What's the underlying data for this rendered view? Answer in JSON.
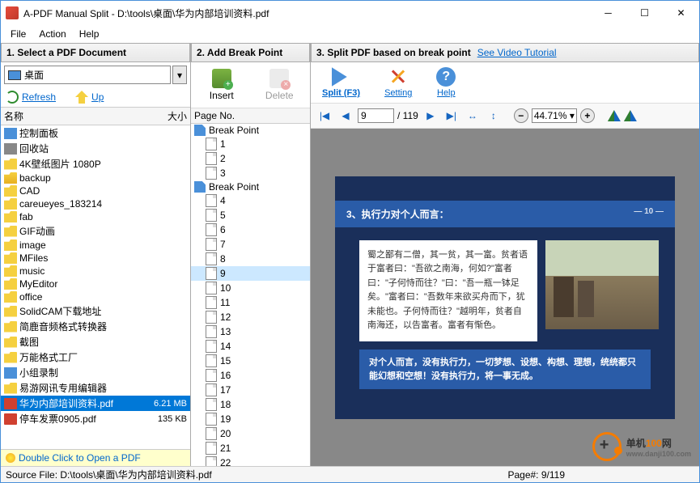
{
  "window": {
    "title": "A-PDF Manual Split - D:\\tools\\桌面\\华为内部培训资料.pdf"
  },
  "menu": {
    "file": "File",
    "action": "Action",
    "help": "Help"
  },
  "panels": {
    "left_title": "1. Select a PDF Document",
    "mid_title": "2. Add Break Point",
    "right_title": "3. Split PDF based on break point",
    "video_link": "See Video Tutorial"
  },
  "drive": {
    "label": "桌面"
  },
  "actions": {
    "refresh": "Refresh",
    "up": "Up"
  },
  "file_cols": {
    "name": "名称",
    "size": "大小"
  },
  "files": [
    {
      "icon": "ctrl",
      "name": "控制面板",
      "size": ""
    },
    {
      "icon": "bin",
      "name": "回收站",
      "size": ""
    },
    {
      "icon": "folder",
      "name": "4K壁纸图片 1080P",
      "size": ""
    },
    {
      "icon": "folder-open",
      "name": "backup",
      "size": ""
    },
    {
      "icon": "folder",
      "name": "CAD",
      "size": ""
    },
    {
      "icon": "folder",
      "name": "careueyes_183214",
      "size": ""
    },
    {
      "icon": "folder",
      "name": "fab",
      "size": ""
    },
    {
      "icon": "folder",
      "name": "GIF动画",
      "size": ""
    },
    {
      "icon": "folder",
      "name": "image",
      "size": ""
    },
    {
      "icon": "folder",
      "name": "MFiles",
      "size": ""
    },
    {
      "icon": "folder",
      "name": "music",
      "size": ""
    },
    {
      "icon": "folder",
      "name": "MyEditor",
      "size": ""
    },
    {
      "icon": "folder",
      "name": "office",
      "size": ""
    },
    {
      "icon": "folder",
      "name": "SolidCAM下载地址",
      "size": ""
    },
    {
      "icon": "folder",
      "name": "简鹿音频格式转换器",
      "size": ""
    },
    {
      "icon": "folder",
      "name": "截图",
      "size": ""
    },
    {
      "icon": "folder",
      "name": "万能格式工厂",
      "size": ""
    },
    {
      "icon": "ctrl",
      "name": "小组录制",
      "size": ""
    },
    {
      "icon": "folder",
      "name": "易游网讯专用编辑器",
      "size": ""
    },
    {
      "icon": "pdf",
      "name": "华为内部培训资料.pdf",
      "size": "6.21 MB",
      "selected": true
    },
    {
      "icon": "pdf",
      "name": "停车发票0905.pdf",
      "size": "135 KB"
    }
  ],
  "hint": "Double Click to Open a PDF",
  "mid_tools": {
    "insert": "Insert",
    "delete": "Delete"
  },
  "page_col": "Page No.",
  "pages": [
    {
      "type": "break",
      "label": "Break Point"
    },
    {
      "type": "page",
      "label": "1"
    },
    {
      "type": "page",
      "label": "2"
    },
    {
      "type": "page",
      "label": "3"
    },
    {
      "type": "break",
      "label": "Break Point"
    },
    {
      "type": "page",
      "label": "4"
    },
    {
      "type": "page",
      "label": "5"
    },
    {
      "type": "page",
      "label": "6"
    },
    {
      "type": "page",
      "label": "7"
    },
    {
      "type": "page",
      "label": "8"
    },
    {
      "type": "page",
      "label": "9",
      "selected": true
    },
    {
      "type": "page",
      "label": "10"
    },
    {
      "type": "page",
      "label": "11"
    },
    {
      "type": "page",
      "label": "12"
    },
    {
      "type": "page",
      "label": "13"
    },
    {
      "type": "page",
      "label": "14"
    },
    {
      "type": "page",
      "label": "15"
    },
    {
      "type": "page",
      "label": "16"
    },
    {
      "type": "page",
      "label": "17"
    },
    {
      "type": "page",
      "label": "18"
    },
    {
      "type": "page",
      "label": "19"
    },
    {
      "type": "page",
      "label": "20"
    },
    {
      "type": "page",
      "label": "21"
    },
    {
      "type": "page",
      "label": "22"
    }
  ],
  "right_tools": {
    "split": "Split (F3)",
    "setting": "Setting",
    "help": "Help"
  },
  "nav": {
    "current": "9",
    "total": "/ 119",
    "zoom": "44.71%"
  },
  "slide": {
    "title": "3、执行力对个人而言：",
    "pagenum": "— 10 —",
    "body": "蜀之鄙有二僧，其一贫，其一富。贫者语于富者曰：\"吾欲之南海，何如?\"富者曰：\"子何恃而往？\"曰：\"吾一瓶一钵足矣。\"富者曰：\"吾数年来欲买舟而下，犹未能也。子何恃而往？\"越明年，贫者自南海还，以告富者。富者有惭色。",
    "highlight": "对个人而言，没有执行力，一切梦想、设想、构想、理想，统统都只能幻想和空想！没有执行力，将一事无成。"
  },
  "watermark": {
    "brand1": "单机",
    "brand2": "100",
    "brand3": "网",
    "domain": "www.danji100.com"
  },
  "status": {
    "source": "Source File: D:\\tools\\桌面\\华为内部培训资料.pdf",
    "page": "Page#: 9/119"
  }
}
